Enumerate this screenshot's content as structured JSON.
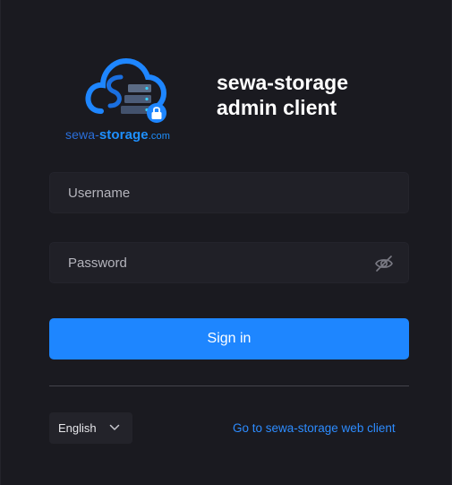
{
  "brand": {
    "logo_word_1": "sewa-",
    "logo_word_2": "storage",
    "logo_word_3": ".com",
    "title_line_1": "sewa-storage",
    "title_line_2": "admin client"
  },
  "form": {
    "username_placeholder": "Username",
    "password_placeholder": "Password",
    "signin_label": "Sign in"
  },
  "footer": {
    "language": "English",
    "web_client_link": "Go to sewa-storage web client"
  },
  "colors": {
    "background": "#1a1a20",
    "input": "#202027",
    "accent": "#1e86ff",
    "link": "#2d8cff",
    "text": "#ffffff"
  },
  "icons": {
    "logo": "cloud-server-lock-icon",
    "password_toggle": "eye-off-icon",
    "language_dropdown": "chevron-down-icon"
  }
}
